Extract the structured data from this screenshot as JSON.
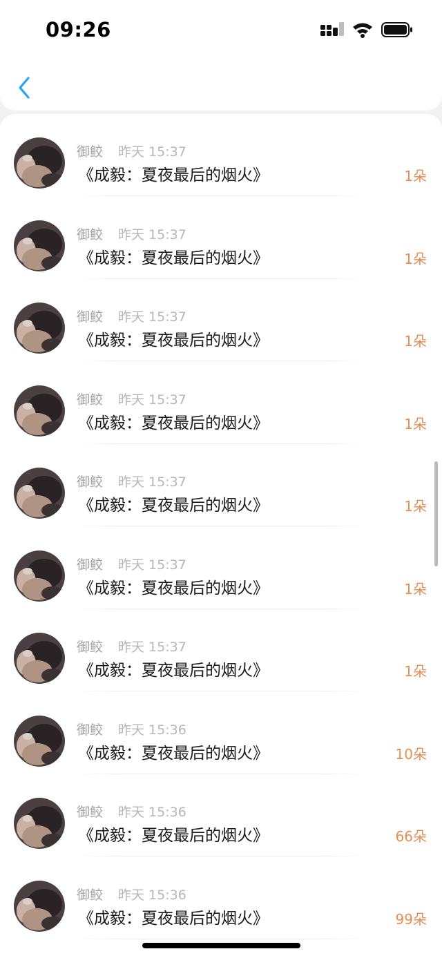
{
  "status_bar": {
    "time": "09:26"
  },
  "header": {
    "back_icon": "chevron-left-icon",
    "accent_color": "#2aa3f2"
  },
  "colors": {
    "count": "#e88d51",
    "name": "#a3a3a3",
    "time": "#b6b6b6"
  },
  "rows": [
    {
      "name": "御鲛",
      "time": "昨天 15:37",
      "title": "《成毅：夏夜最后的烟火》",
      "count": "1朵"
    },
    {
      "name": "御鲛",
      "time": "昨天 15:37",
      "title": "《成毅：夏夜最后的烟火》",
      "count": "1朵"
    },
    {
      "name": "御鲛",
      "time": "昨天 15:37",
      "title": "《成毅：夏夜最后的烟火》",
      "count": "1朵"
    },
    {
      "name": "御鲛",
      "time": "昨天 15:37",
      "title": "《成毅：夏夜最后的烟火》",
      "count": "1朵"
    },
    {
      "name": "御鲛",
      "time": "昨天 15:37",
      "title": "《成毅：夏夜最后的烟火》",
      "count": "1朵"
    },
    {
      "name": "御鲛",
      "time": "昨天 15:37",
      "title": "《成毅：夏夜最后的烟火》",
      "count": "1朵"
    },
    {
      "name": "御鲛",
      "time": "昨天 15:37",
      "title": "《成毅：夏夜最后的烟火》",
      "count": "1朵"
    },
    {
      "name": "御鲛",
      "time": "昨天 15:36",
      "title": "《成毅：夏夜最后的烟火》",
      "count": "10朵"
    },
    {
      "name": "御鲛",
      "time": "昨天 15:36",
      "title": "《成毅：夏夜最后的烟火》",
      "count": "66朵"
    },
    {
      "name": "御鲛",
      "time": "昨天 15:36",
      "title": "《成毅：夏夜最后的烟火》",
      "count": "99朵"
    }
  ]
}
